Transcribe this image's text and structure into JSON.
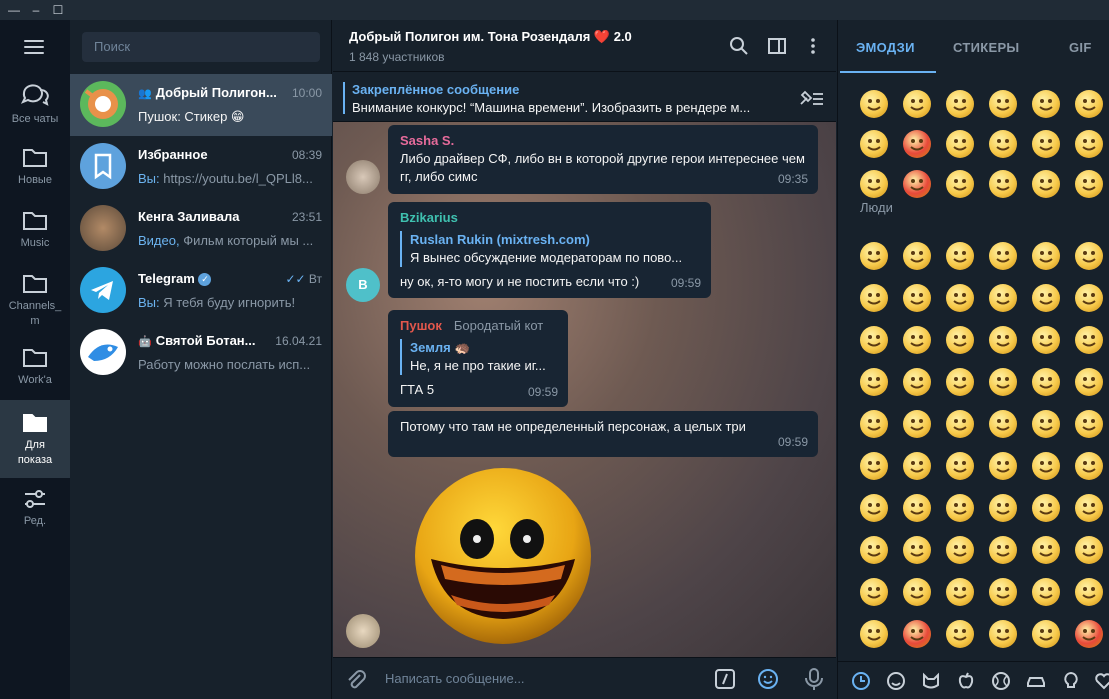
{
  "window": {
    "minimize": "—",
    "maximize": "☐",
    "close": "✕"
  },
  "rail": {
    "folders": [
      {
        "label": "Все чаты",
        "icon": "chats-icon"
      },
      {
        "label": "Новые",
        "icon": "folder-icon"
      },
      {
        "label": "Music",
        "icon": "folder-icon"
      },
      {
        "label": "Channels_\nm",
        "icon": "folder-icon"
      },
      {
        "label": "Work'a",
        "icon": "folder-icon"
      },
      {
        "label": "Для показа",
        "icon": "folder-icon"
      },
      {
        "label": "Ред.",
        "icon": "edit-folders-icon"
      }
    ]
  },
  "search": {
    "placeholder": "Поиск"
  },
  "chats": [
    {
      "name": "Добрый Полигон...",
      "time": "10:00",
      "message": "Пушок: Стикер 😁",
      "prefix": "",
      "group": true
    },
    {
      "name": "Избранное",
      "time": "08:39",
      "prefix": "Вы: ",
      "message": "https://youtu.be/l_QPLl8..."
    },
    {
      "name": "Кенга Заливала",
      "time": "23:51",
      "prefix": "Видео, ",
      "message": "Фильм который мы ..."
    },
    {
      "name": "Telegram",
      "time": "Вт",
      "prefix": "Вы: ",
      "message": "Я тебя буду игнорить!"
    },
    {
      "name": "Святой Ботан...",
      "time": "16.04.21",
      "prefix": "",
      "message": "Работу можно послать исп..."
    }
  ],
  "header": {
    "title": "Добрый Полигон им. Тона Розендаля ❤️ 2.0",
    "subtitle": "1 848 участников"
  },
  "pinned": {
    "title": "Закреплённое сообщение",
    "text": "Внимание конкурс! “Машина времени”. Изобразить в рендере м..."
  },
  "messages": [
    {
      "author": "Sasha S.",
      "author_color": "#e66b9b",
      "text": "Либо драйвер СФ, либо вн в которой другие герои интереснее чем гг, либо симс",
      "time": "09:35"
    },
    {
      "author": "Bzikarius",
      "author_color": "#6ab2f2",
      "reply_name": "Ruslan Rukin (mixtresh.com)",
      "reply_text": "Я вынес обсуждение модераторам по пово...",
      "text": "ну ок, я-то могу и не  постить если что :)",
      "time": "09:59",
      "avatar_letter": "B"
    },
    {
      "author": "Пушок",
      "author_color": "#e2574c",
      "author_title": "Бородатый кот",
      "reply_name": "Земля 🦔",
      "reply_text": "Не, я не про такие иг...",
      "text": "ГТА 5",
      "time": "09:59"
    },
    {
      "text": "Потому что там не определенный персонаж, а целых три",
      "time": "09:59"
    }
  ],
  "composer": {
    "placeholder": "Написать сообщение..."
  },
  "emoji_panel": {
    "tabs": [
      "ЭМОДЗИ",
      "СТИКЕРЫ",
      "GIF"
    ],
    "section_people": "Люди",
    "colors": {
      "accent": "#6ab2f2",
      "face": "#f7c94a",
      "face_red": "#e8493a",
      "face_blue": "#6fb8e8"
    }
  }
}
